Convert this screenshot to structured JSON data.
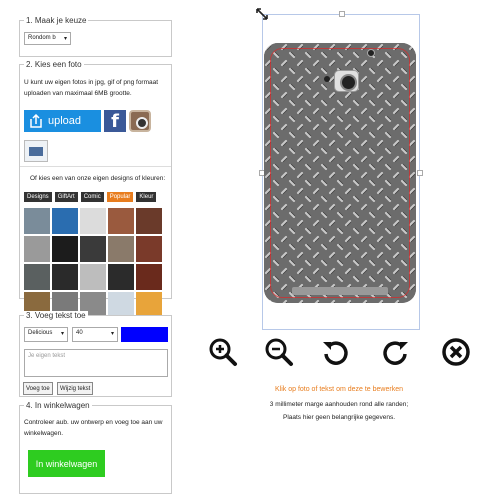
{
  "step1": {
    "legend": "1. Maak je keuze",
    "select_value": "Rondom b"
  },
  "step2": {
    "legend": "2. Kies een foto",
    "intro": "U kunt uw eigen fotos in jpg, gif of png formaat uploaden van maximaal 6MB grootte.",
    "upload_label": "upload",
    "designs_intro": "Of kies een van onze eigen designs of kleuren:",
    "tabs": [
      "Designs",
      "GiftArt",
      "Comic",
      "Popular",
      "Kleur"
    ],
    "active_tab": "Popular",
    "swatches": [
      "#7a8c9a",
      "#2a6db0",
      "#dcdcdc",
      "#9a5a3e",
      "#6a3a2a",
      "#9a9a9a",
      "#1c1c1c",
      "#3a3a3a",
      "#8a7a6a",
      "#7a3a2a",
      "#5a6060",
      "#2a2a2a",
      "#bdbdbd",
      "#2b2b2b",
      "#6a2a1c",
      "#8a6a3e",
      "#7a7a7a",
      "#8a8a8a",
      "#cfd9e2",
      "#e8a43a"
    ]
  },
  "step3": {
    "legend": "3. Voeg tekst toe",
    "font_value": "Delicious",
    "size_value": "40",
    "color": "#0000ff",
    "placeholder": "Je eigen tekst",
    "add_label": "Voeg toe",
    "edit_label": "Wijzig tekst"
  },
  "step4": {
    "legend": "4. In winkelwagen",
    "text": "Controleer aub. uw ontwerp en voeg toe aan uw winkelwagen.",
    "cart_label": "In winkelwagen"
  },
  "editor": {
    "tools": [
      "zoom-in-icon",
      "zoom-out-icon",
      "rotate-left-icon",
      "rotate-right-icon",
      "delete-icon"
    ],
    "hint_primary": "Klik op foto of tekst om deze te bewerken",
    "hint_margin": "3 millimeter marge aanhouden rond alle randen;",
    "hint_data": "Plaats hier geen belangrijke gegevens."
  }
}
